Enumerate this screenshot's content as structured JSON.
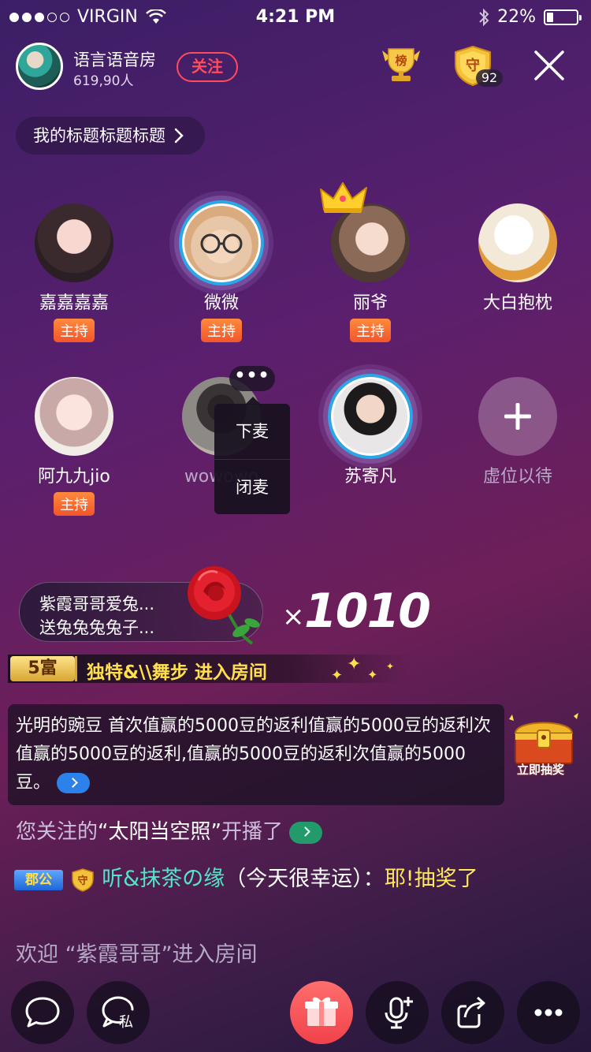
{
  "status_bar": {
    "carrier": "VIRGIN",
    "time": "4:21 PM",
    "battery": "22%",
    "battery_level": 0.22
  },
  "header": {
    "room_name": "语言语音房",
    "audience_count": "619,90人",
    "follow_label": "关注",
    "rank_icon_text": "榜",
    "guard_icon_text": "守",
    "guard_count": "92"
  },
  "topic": {
    "label": "我的标题标题标题"
  },
  "seats": [
    {
      "name": "嘉嘉嘉嘉",
      "badge": "主持",
      "speaking": false
    },
    {
      "name": "微微",
      "badge": "主持",
      "speaking": true
    },
    {
      "name": "丽爷",
      "badge": "主持",
      "speaking": false
    },
    {
      "name": "大白抱枕",
      "badge": "",
      "speaking": false
    },
    {
      "name": "阿九九jio",
      "badge": "主持",
      "speaking": false
    },
    {
      "name": "wowowo",
      "badge": "",
      "speaking": false
    },
    {
      "name": "苏寄凡",
      "badge": "",
      "speaking": true
    },
    {
      "name": "虚位以待",
      "badge": "",
      "speaking": false
    }
  ],
  "seat_menu": {
    "more_label": "•••",
    "items": [
      "下麦",
      "闭麦"
    ]
  },
  "gift_banner": {
    "line1": "紫霞哥哥爱兔...",
    "line2": "送兔兔兔兔子...",
    "multiplier": "×",
    "count": "1010"
  },
  "entry_notice": {
    "badge": "5富",
    "text": "独特&\\\\舞步 进入房间"
  },
  "messages": {
    "system": "光明的豌豆 首次值赢的5000豆的返利值赢的5000豆的返利次值赢的5000豆的返利,值赢的5000豆的返利次值赢的5000豆。",
    "lottery_label": "立即抽奖",
    "follow_prefix": "您关注的",
    "follow_name": "“太阳当空照”",
    "follow_suffix": "开播了",
    "chat_club": "郡公",
    "chat_guard": "守",
    "chat_name": "听&抹茶の缘",
    "chat_body": "（今天很幸运）：",
    "chat_text": "耶!抽奖了",
    "welcome": "欢迎 “紫霞哥哥”进入房间"
  },
  "bottom_bar": {
    "private_label": "私"
  }
}
